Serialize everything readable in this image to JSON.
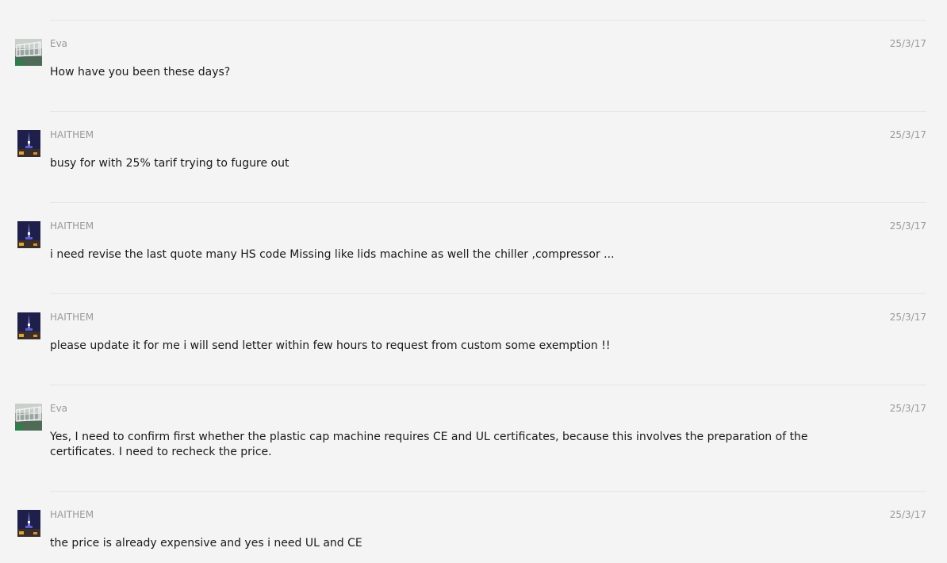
{
  "messages": [
    {
      "sender": "Eva",
      "date": "25/3/17",
      "text": "How have you been these days?",
      "avatar": "eva-avatar"
    },
    {
      "sender": "HAITHEM",
      "date": "25/3/17",
      "text": "busy for with 25% tarif trying to fugure out",
      "avatar": "haithem-avatar"
    },
    {
      "sender": "HAITHEM",
      "date": "25/3/17",
      "text": "i need revise the last quote many HS code Missing like lids machine as well the chiller ,compressor ...",
      "avatar": "haithem-avatar"
    },
    {
      "sender": "HAITHEM",
      "date": "25/3/17",
      "text": "please update it for me i will send letter within few hours to request from custom some exemption !!",
      "avatar": "haithem-avatar"
    },
    {
      "sender": "Eva",
      "date": "25/3/17",
      "text": "Yes, I need to confirm first whether the plastic cap machine requires CE and UL certificates, because this involves the preparation of the certificates. I need to recheck the price.",
      "avatar": "eva-avatar"
    },
    {
      "sender": "HAITHEM",
      "date": "25/3/17",
      "text": "the price is already expensive and yes i need UL and CE",
      "avatar": "haithem-avatar"
    }
  ]
}
